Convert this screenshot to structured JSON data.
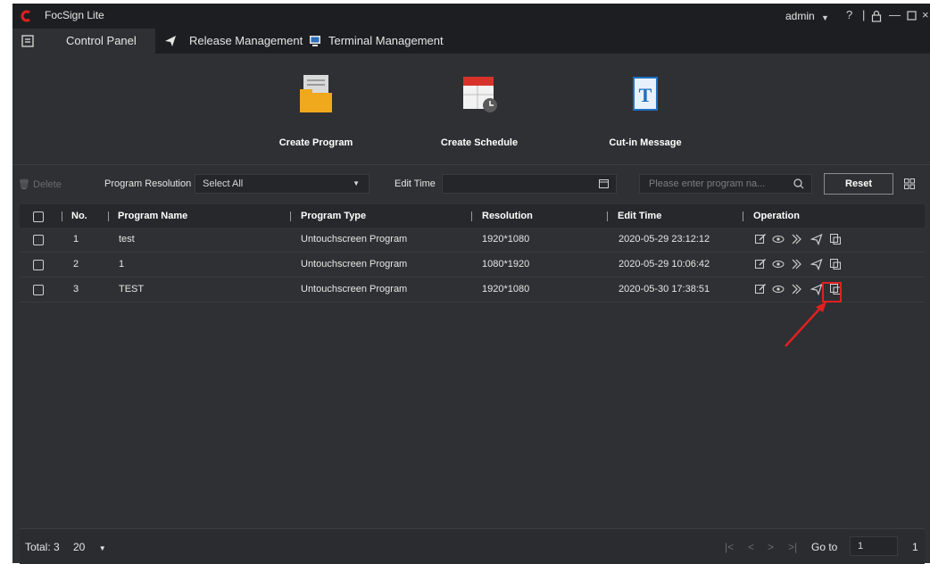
{
  "window": {
    "app_title": "FocSign Lite",
    "user": "admin",
    "icons": [
      "help-icon",
      "lock-icon",
      "minimize-icon",
      "maximize-icon",
      "close-icon"
    ],
    "accent": "#e02020"
  },
  "tabs": [
    {
      "label": "Control Panel",
      "icon": "panel-icon",
      "active": true
    },
    {
      "label": "Release Management",
      "icon": "send-icon",
      "active": false
    },
    {
      "label": "Terminal Management",
      "icon": "monitor-icon",
      "active": false
    }
  ],
  "quick_actions": [
    {
      "label": "Create Program",
      "icon": "folder-document-icon"
    },
    {
      "label": "Create Schedule",
      "icon": "calendar-clock-icon"
    },
    {
      "label": "Cut-in Message",
      "icon": "text-document-icon"
    }
  ],
  "filters": {
    "delete_label": "Delete",
    "resolution_label": "Program Resolution",
    "resolution_value": "Select All",
    "edit_time_label": "Edit Time",
    "edit_time_value": "",
    "search_placeholder": "Please enter program na...",
    "reset_label": "Reset"
  },
  "table": {
    "columns": [
      "No.",
      "Program Name",
      "Program Type",
      "Resolution",
      "Edit Time",
      "Operation"
    ],
    "rows": [
      {
        "no": "1",
        "name": "test",
        "type": "Untouchscreen Program",
        "resolution": "1920*1080",
        "edit_time": "2020-05-29 23:12:12"
      },
      {
        "no": "2",
        "name": "1",
        "type": "Untouchscreen Program",
        "resolution": "1080*1920",
        "edit_time": "2020-05-29 10:06:42"
      },
      {
        "no": "3",
        "name": "TEST",
        "type": "Untouchscreen Program",
        "resolution": "1920*1080",
        "edit_time": "2020-05-30 17:38:51"
      }
    ],
    "operations": [
      "edit-icon",
      "preview-icon",
      "publish-icon",
      "send-icon",
      "copy-icon"
    ]
  },
  "footer": {
    "total_label": "Total: 3",
    "page_size": "20",
    "goto_label": "Go to",
    "goto_value": "1",
    "total_pages": "1"
  }
}
